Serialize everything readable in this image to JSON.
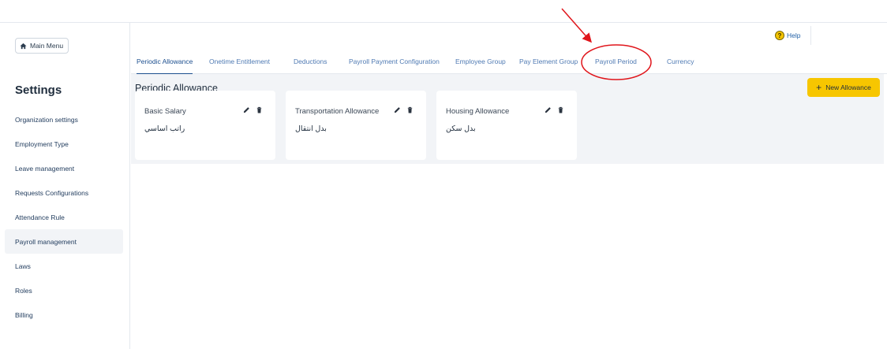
{
  "sidebar": {
    "main_menu_label": "Main Menu",
    "title": "Settings",
    "items": [
      {
        "label": "Organization settings"
      },
      {
        "label": "Employment Type"
      },
      {
        "label": "Leave management"
      },
      {
        "label": "Requests Configurations"
      },
      {
        "label": "Attendance Rule"
      },
      {
        "label": "Payroll management"
      },
      {
        "label": "Laws"
      },
      {
        "label": "Roles"
      },
      {
        "label": "Billing"
      }
    ],
    "active_item": "Payroll management"
  },
  "header": {
    "help_label": "Help",
    "help_icon": "?"
  },
  "tabs": [
    {
      "label": "Periodic Allowance"
    },
    {
      "label": "Onetime Entitlement"
    },
    {
      "label": "Deductions"
    },
    {
      "label": "Payroll Payment Configuration"
    },
    {
      "label": "Employee Group"
    },
    {
      "label": "Pay Element Group"
    },
    {
      "label": "Payroll Period"
    },
    {
      "label": "Currency"
    }
  ],
  "active_tab": "Periodic Allowance",
  "panel": {
    "title": "Periodic Allowance",
    "new_button_label": "New Allowance",
    "new_button_icon": "+"
  },
  "cards": [
    {
      "name": "Basic Salary",
      "name_ar": "راتب اساسي"
    },
    {
      "name": "Transportation Allowance",
      "name_ar": "بدل انتقال"
    },
    {
      "name": "Housing Allowance",
      "name_ar": "بدل سكن"
    }
  ],
  "colors": {
    "accent": "#1c4f8f",
    "button_yellow": "#f7c600",
    "annotation_red": "#e0151b"
  }
}
